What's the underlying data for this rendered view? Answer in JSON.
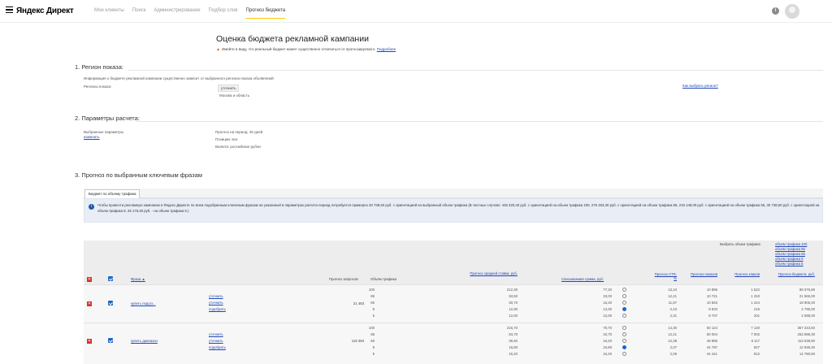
{
  "header": {
    "logo": "Яндекс Директ",
    "nav": [
      "Мои клиенты",
      "Поиск",
      "Администрирование",
      "Подбор слов",
      "Прогноз бюджета"
    ],
    "info_icon": "i"
  },
  "page": {
    "title": "Оценка бюджета рекламной кампании",
    "warning_prefix": "Имейте в виду, что реальный бюджет может существенно отличаться от прогнозируемого.",
    "warning_link": "Подробнее"
  },
  "region": {
    "heading": "1. Регион показа:",
    "note": "Информация о бюджете рекламной кампании существенно зависит от выбранного региона показа объявлений",
    "label": "Регионы показа:",
    "button": "уточнить",
    "value": "Москва и область",
    "link": "Как выбрать регион?"
  },
  "params": {
    "heading": "2. Параметры расчета:",
    "selected_label": "Выбранные параметры",
    "change_link": "изменить",
    "period": "Прогноз на период: 30 дней",
    "positions": "Позиции: все",
    "currency": "Валюта: российские рубли"
  },
  "forecast": {
    "heading": "3. Прогноз по выбранным ключевым фразам",
    "tab": "Бюджет по объему трафика",
    "info": "Чтобы провести рекламную кампанию в Яндекс.Директе по всем подобранным ключевым фразам на указанный в параметрах расчета период потребуется примерно 30 738,50 руб. с ориентацией на выбранный объем трафика (В частных случаях: 445 320,40 руб. с ориентацией на объем трафика 100, 275 463,30 руб. с ориентацией на объем трафика 85, 219 148,00 руб. с ориентацией на объем трафика 65, 30 738,50 руб. с ориентацией на объем трафика 9, 25 176,30 руб. - на объем трафика 5.)",
    "traffic_select_label": "Выбрать объем трафика:",
    "traffic_links": [
      "объём трафика 100",
      "объём трафика 85",
      "объём трафика 65",
      "объём трафика 9",
      "объём трафика 5"
    ],
    "columns": {
      "phrase": "Фраза ▲",
      "requests": "Прогноз запросов",
      "traffic": "Объём трафика",
      "bid": "Прогноз средней ставки, руб.",
      "charge": "Списываемая сумма, руб.",
      "ctr": "Прогноз CTR, %",
      "shows": "Прогноз показов",
      "clicks": "Прогноз кликов",
      "budget": "Прогноз бюджета, руб."
    },
    "rows": [
      {
        "phrase": "купить подгуз...",
        "actions": [
          "уточнить",
          "уточнить",
          "подобрать"
        ],
        "requests": "21 483",
        "traffic": [
          "100",
          "85",
          "65",
          "9",
          "5"
        ],
        "bid": [
          "212,30",
          "93,50",
          "30,70",
          "12,90",
          "12,00"
        ],
        "charge": [
          "77,20",
          "33,00",
          "15,20",
          "13,30",
          "12,00"
        ],
        "radio_selected": 3,
        "ctr": [
          "13,10",
          "12,21",
          "11,67",
          "2,43",
          "2,31"
        ],
        "shows": [
          "10 886",
          "10 721",
          "10 663",
          "8 833",
          "8 707"
        ],
        "clicks": [
          "1 522",
          "1 310",
          "1 244",
          "215",
          "201"
        ],
        "budget": [
          "88 076,80",
          "21 565,00",
          "18 905,20",
          "2 795,00",
          "2 088,00"
        ]
      },
      {
        "phrase": "купить диапазон",
        "actions": [
          "уточнить",
          "уточнить",
          "подобрать"
        ],
        "requests": "119 383",
        "traffic": [
          "100",
          "85",
          "65",
          "9",
          "5"
        ],
        "bid": [
          "216,70",
          "83,70",
          "36,60",
          "16,80",
          "16,20"
        ],
        "charge": [
          "78,70",
          "33,70",
          "15,20",
          "16,80",
          "16,20"
        ],
        "radio_selected": 3,
        "ctr": [
          "14,30",
          "12,21",
          "12,38",
          "2,07",
          "2,05"
        ],
        "shows": [
          "50 124",
          "50 004",
          "49 885",
          "44 797",
          "44 441"
        ],
        "clicks": [
          "7 140",
          "7 002",
          "6 117",
          "927",
          "912"
        ],
        "budget": [
          "357 243,60",
          "253 898,30",
          "113 638,80",
          "12 936,30",
          "14 780,50"
        ]
      }
    ]
  }
}
